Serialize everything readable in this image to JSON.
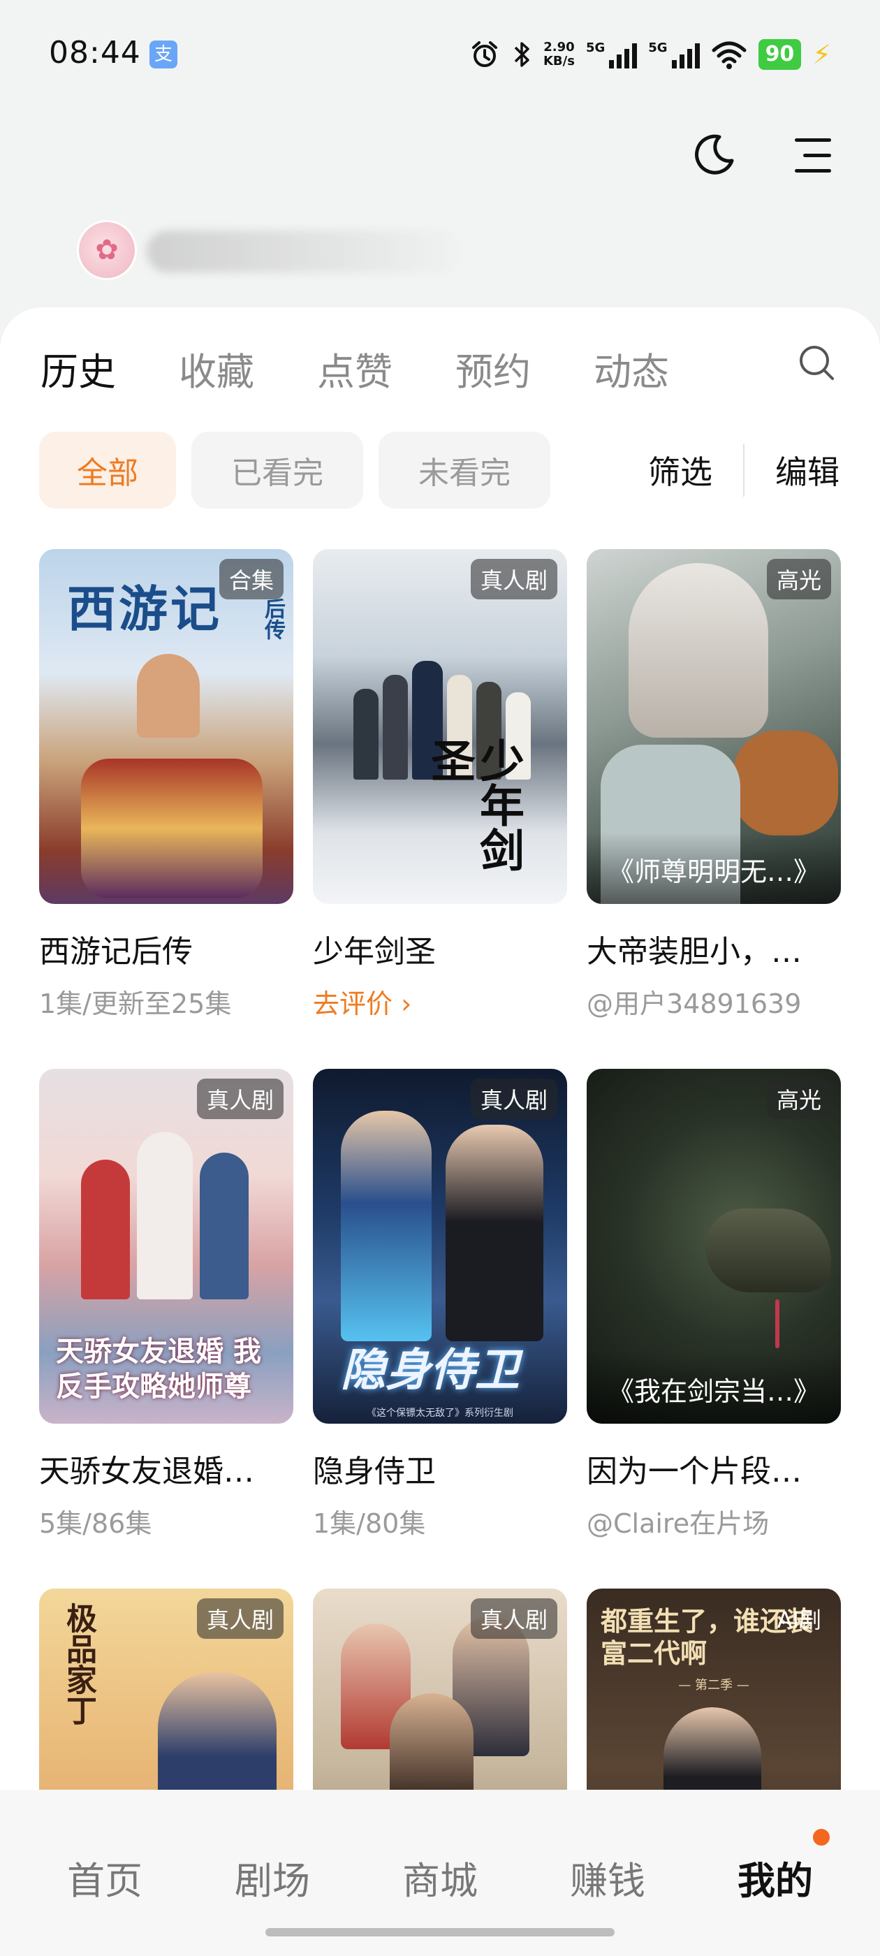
{
  "status_bar": {
    "time": "08:44",
    "alipay_glyph": "支",
    "net_speed_value": "2.90",
    "net_speed_unit": "KB/s",
    "sim1": "5G",
    "sim2": "5G",
    "battery": "90"
  },
  "profile": {
    "avatar_glyph": "✿"
  },
  "tabs": [
    {
      "label": "历史",
      "active": true
    },
    {
      "label": "收藏",
      "active": false
    },
    {
      "label": "点赞",
      "active": false
    },
    {
      "label": "预约",
      "active": false
    },
    {
      "label": "动态",
      "active": false
    }
  ],
  "filters": {
    "chips": [
      "全部",
      "已看完",
      "未看完"
    ],
    "active_chip": "全部",
    "filter_label": "筛选",
    "edit_label": "编辑"
  },
  "cards": [
    {
      "badge": "合集",
      "title": "西游记后传",
      "sub": "1集/更新至25集",
      "sub_style": "gray",
      "poster_text": "西游记",
      "poster_side": "后传"
    },
    {
      "badge": "真人剧",
      "title": "少年剑圣",
      "sub": "去评价 ›",
      "sub_style": "orange",
      "poster_text": "少年剑圣"
    },
    {
      "badge": "高光",
      "title": "大帝装胆小，…",
      "sub": "@用户34891639",
      "sub_style": "gray",
      "clip_title": "《师尊明明无…》"
    },
    {
      "badge": "真人剧",
      "title": "天骄女友退婚…",
      "sub": "5集/86集",
      "sub_style": "gray",
      "poster_text": "天骄女友退婚 我反手攻略她师尊"
    },
    {
      "badge": "真人剧",
      "title": "隐身侍卫",
      "sub": "1集/80集",
      "sub_style": "gray",
      "poster_text": "隐身侍卫",
      "poster_small": "《这个保镖太无敌了》系列衍生剧"
    },
    {
      "badge": "高光",
      "title": "因为一个片段…",
      "sub": "@Claire在片场",
      "sub_style": "gray",
      "clip_title": "《我在剑宗当…》"
    },
    {
      "badge": "真人剧",
      "poster_text": "极品家丁"
    },
    {
      "badge": "真人剧"
    },
    {
      "badge": "AI剧",
      "poster_text": "都重生了，谁还装富二代啊",
      "poster_small": "— 第二季 —"
    }
  ],
  "bottom_nav": [
    {
      "label": "首页",
      "active": false
    },
    {
      "label": "剧场",
      "active": false
    },
    {
      "label": "商城",
      "active": false
    },
    {
      "label": "赚钱",
      "active": false
    },
    {
      "label": "我的",
      "active": true
    }
  ],
  "colors": {
    "accent": "#ee7b20",
    "notification_dot": "#f4671f",
    "battery": "#3fcb42"
  }
}
